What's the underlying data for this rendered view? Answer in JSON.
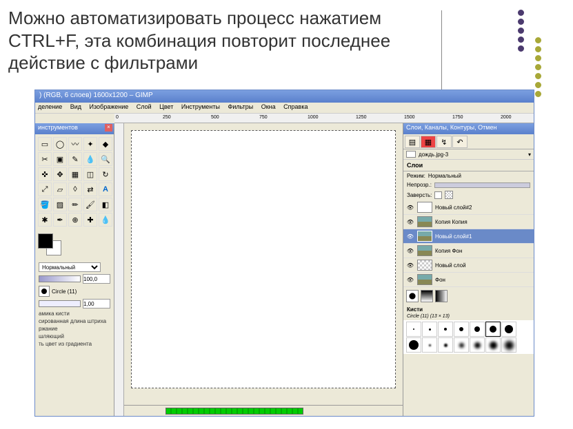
{
  "slide": {
    "title": "Можно автоматизировать процесс нажатием CTRL+F, эта комбинация повторит последнее действие с фильтрами"
  },
  "window": {
    "title": ") (RGB, 6 слоев) 1600x1200 – GIMP"
  },
  "menu": {
    "items": [
      "деление",
      "Вид",
      "Изображение",
      "Слой",
      "Цвет",
      "Инструменты",
      "Фильтры",
      "Окна",
      "Справка"
    ]
  },
  "ruler": {
    "marks": [
      "0",
      "250",
      "500",
      "750",
      "1000",
      "1250",
      "1500",
      "1750",
      "2000"
    ]
  },
  "toolbox": {
    "title": "инструментов",
    "mode_label": "Нормальный",
    "opacity": "100,0",
    "brush_name": "Circle (11)",
    "scale": "1,00",
    "opts": [
      "амика кисти",
      "сированная длина штриха",
      "ржание",
      "шляющий",
      "ть цвет из градиента"
    ]
  },
  "right": {
    "title": "Слои, Каналы, Контуры, Отмен",
    "filename": "дождь.jpg-3",
    "layers_hdr": "Слои",
    "mode_label": "Режим:",
    "mode_val": "Нормальный",
    "opacity_label": "Непрозр.:",
    "lock_label": "Заверсть:",
    "layers": [
      {
        "name": "Новый слой#2",
        "type": "blank"
      },
      {
        "name": "Копия Копия",
        "type": "img"
      },
      {
        "name": "Новый слой#1",
        "type": "img",
        "sel": true
      },
      {
        "name": "Копия Фон",
        "type": "img"
      },
      {
        "name": "Новый слой",
        "type": "checker"
      },
      {
        "name": "Фон",
        "type": "img"
      }
    ],
    "brushes_hdr": "Кисти",
    "brushes_sub": "Circle (11) (13 × 13)"
  }
}
